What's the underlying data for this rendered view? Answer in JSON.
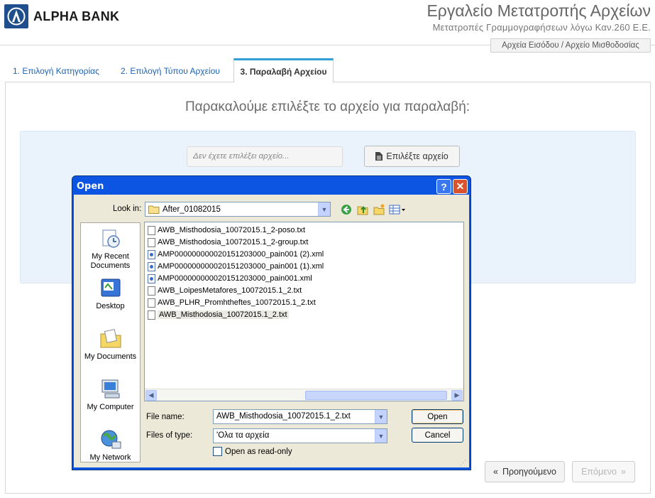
{
  "header": {
    "brand": "ALPHA BANK",
    "app_title": "Εργαλείο Μετατροπής Αρχείων",
    "app_subtitle": "Μετατροπές Γραμμογραφήσεων λόγω Καν.260 Ε.Ε.",
    "breadcrumb": "Αρχεία Εισόδου / Αρχείο Μισθοδοσίας"
  },
  "tabs": [
    {
      "label": "1. Επιλογή Κατηγορίας"
    },
    {
      "label": "2. Επιλογή Τύπου Αρχείου"
    },
    {
      "label": "3. Παραλαβή Αρχείου"
    }
  ],
  "main": {
    "prompt": "Παρακαλούμε επιλέξτε το αρχείο για παραλαβή:",
    "file_placeholder": "Δεν έχετε επιλέξει αρχείο...",
    "choose_button": "Επιλέξτε αρχείο",
    "prev_button": "Προηγούμενο",
    "next_button": "Επόμενο"
  },
  "dialog": {
    "title": "Open",
    "look_in_label": "Look in:",
    "look_in_value": "After_01082015",
    "places": [
      {
        "label": "My Recent Documents",
        "icon": "recent-documents-icon"
      },
      {
        "label": "Desktop",
        "icon": "desktop-icon"
      },
      {
        "label": "My Documents",
        "icon": "my-documents-icon"
      },
      {
        "label": "My Computer",
        "icon": "my-computer-icon"
      },
      {
        "label": "My Network",
        "icon": "my-network-icon"
      }
    ],
    "files": [
      {
        "name": "AWB_Misthodosia_10072015.1_2-poso.txt",
        "type": "txt"
      },
      {
        "name": "AWB_Misthodosia_10072015.1_2-group.txt",
        "type": "txt"
      },
      {
        "name": "AMP000000000020151203000_pain001 (2).xml",
        "type": "xml"
      },
      {
        "name": "AMP000000000020151203000_pain001 (1).xml",
        "type": "xml"
      },
      {
        "name": "AMP000000000020151203000_pain001.xml",
        "type": "xml"
      },
      {
        "name": "AWB_LoipesMetafores_10072015.1_2.txt",
        "type": "txt"
      },
      {
        "name": "AWB_PLHR_Promhtheftes_10072015.1_2.txt",
        "type": "txt"
      },
      {
        "name": "AWB_Misthodosia_10072015.1_2.txt",
        "type": "txt",
        "selected": true
      }
    ],
    "file_name_label": "File name:",
    "file_name_value": "AWB_Misthodosia_10072015.1_2.txt",
    "file_type_label": "Files of type:",
    "file_type_value": "'Ολα τα αρχεία",
    "readonly_label": "Open as read-only",
    "open_button": "Open",
    "cancel_button": "Cancel"
  }
}
